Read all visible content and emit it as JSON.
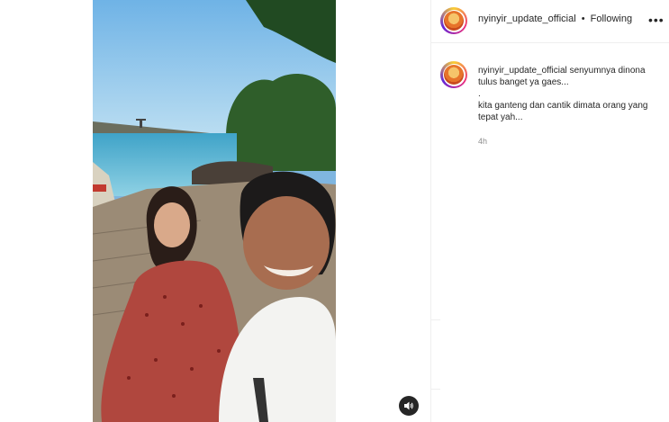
{
  "post": {
    "username": "nyinyir_update_official",
    "follow_status": "Following",
    "separator": "•",
    "more_label": "•••",
    "caption_text": "senyumnya dinona tulus banget ya gaes...\n.\nkita ganteng dan cantik dimata orang yang tepat yah...",
    "timestamp": "4h"
  },
  "video": {
    "sound_icon": "speaker-icon"
  }
}
